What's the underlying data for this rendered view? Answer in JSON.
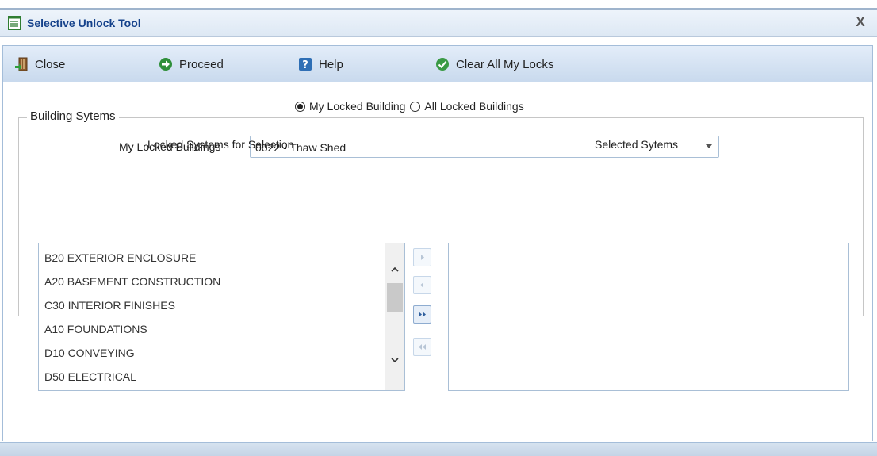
{
  "window": {
    "title": "Selective Unlock Tool",
    "close_glyph": "X"
  },
  "toolbar": {
    "close_label": "Close",
    "proceed_label": "Proceed",
    "help_label": "Help",
    "clear_label": "Clear All My Locks"
  },
  "radio": {
    "options": [
      "My Locked Building",
      "All Locked Buildings"
    ],
    "selected": "My Locked Building"
  },
  "building_field": {
    "label": "My Locked Buildings",
    "value": "0022 - Thaw Shed"
  },
  "systems": {
    "legend": "Building Sytems",
    "available_header": "Locked Systems for Selection",
    "selected_header": "Selected Sytems",
    "available_items": [
      "B20 EXTERIOR ENCLOSURE",
      "A20 BASEMENT CONSTRUCTION",
      "C30 INTERIOR FINISHES",
      "A10 FOUNDATIONS",
      "D10 CONVEYING",
      "D50 ELECTRICAL"
    ],
    "selected_items": []
  },
  "colors": {
    "title_text": "#15428b",
    "toolbar_bg": "#c8d9ed",
    "border": "#a4bdd9"
  }
}
